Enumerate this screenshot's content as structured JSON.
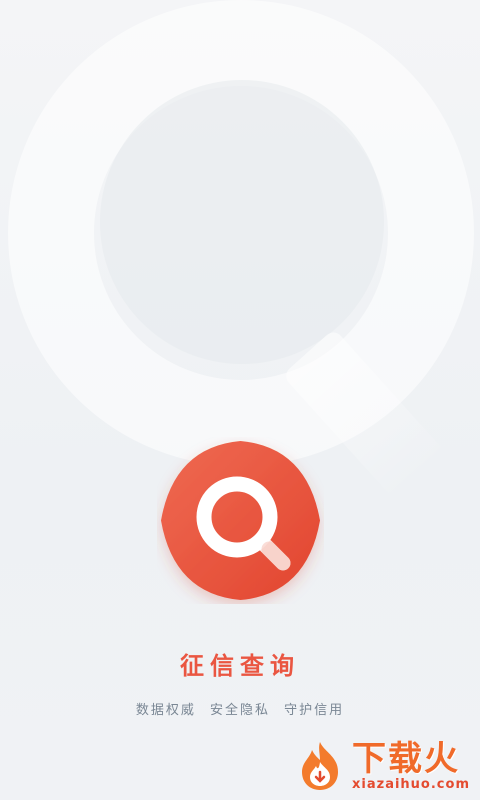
{
  "app": {
    "name": "征信查询",
    "slogans": [
      "数据权威",
      "安全隐私",
      "守护信用"
    ]
  },
  "logo": {
    "icon": "magnifier-eye-logo",
    "color": "#ea5641"
  },
  "watermark": {
    "text": "下载火",
    "url": "xiazaihuo.com",
    "color": "#f06a2a"
  }
}
